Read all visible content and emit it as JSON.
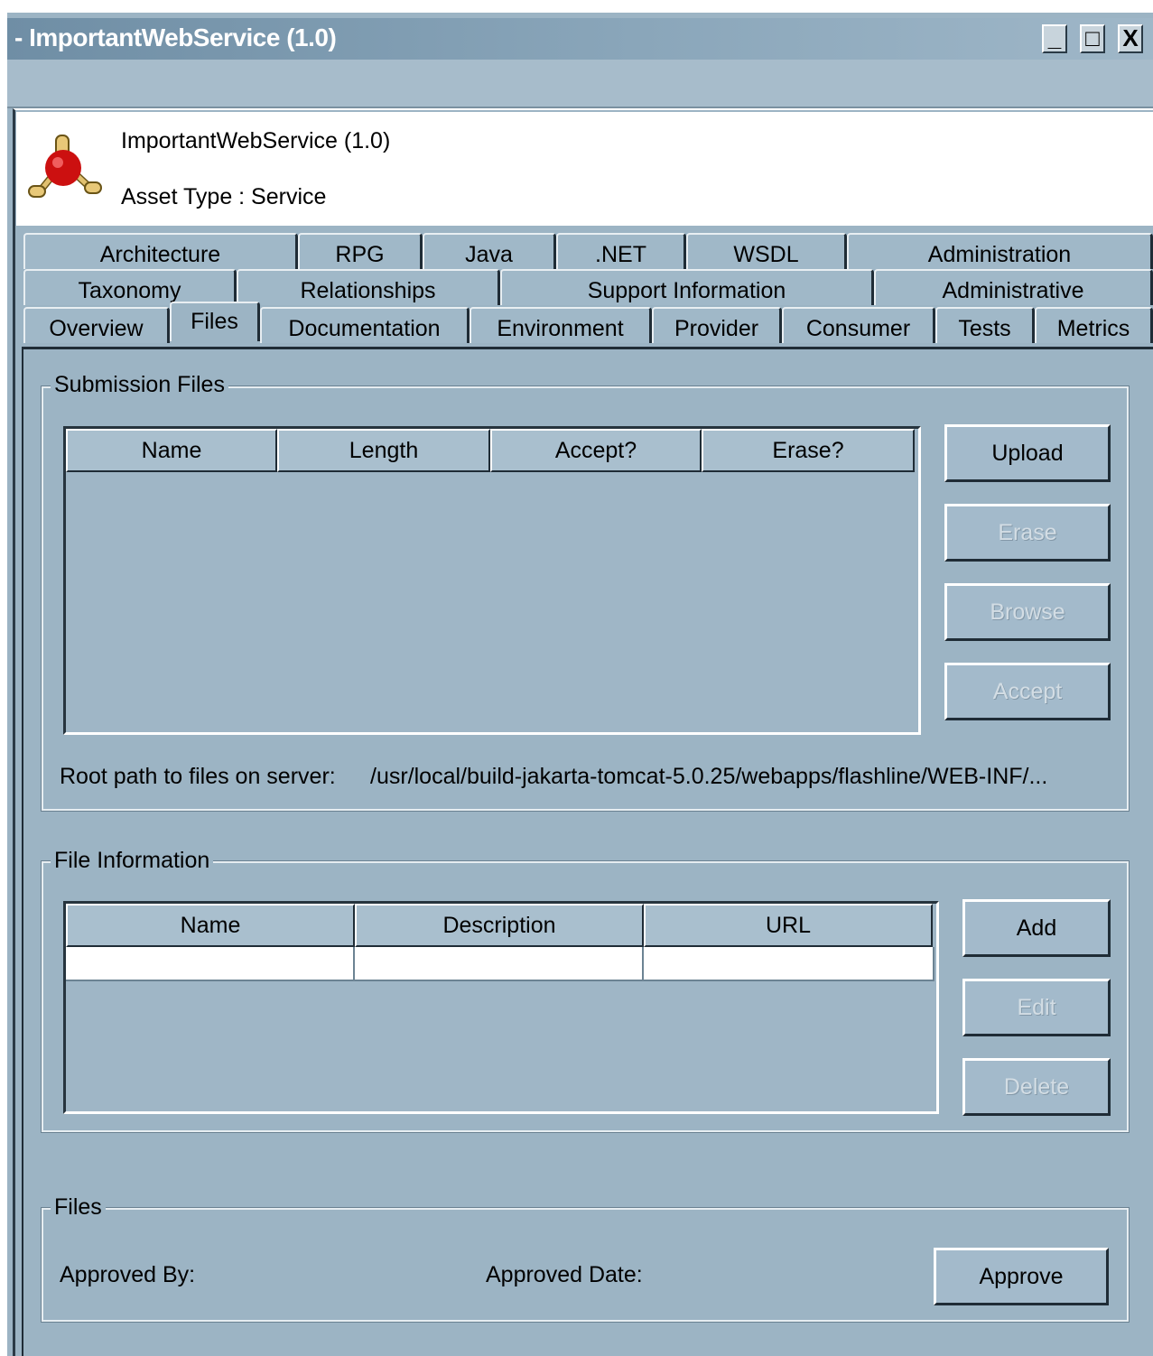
{
  "window": {
    "title": "- ImportantWebService (1.0)",
    "controls": {
      "minimize": "_",
      "maximize": "□",
      "close": "X"
    }
  },
  "header": {
    "asset_name": "ImportantWebService (1.0)",
    "asset_type": "Asset Type : Service",
    "icon": "service-molecule-icon"
  },
  "tabs": {
    "row1": [
      "Architecture",
      "RPG",
      "Java",
      ".NET",
      "WSDL",
      "Administration"
    ],
    "row2": [
      "Taxonomy",
      "Relationships",
      "Support Information",
      "Administrative"
    ],
    "row3": [
      "Overview",
      "Files",
      "Documentation",
      "Environment",
      "Provider",
      "Consumer",
      "Tests",
      "Metrics"
    ],
    "active": "Files"
  },
  "submission_files": {
    "title": "Submission Files",
    "columns": [
      "Name",
      "Length",
      "Accept?",
      "Erase?"
    ],
    "rows": [],
    "buttons": {
      "upload": "Upload",
      "erase": "Erase",
      "browse": "Browse",
      "accept": "Accept"
    },
    "root_path_label": "Root path to files on server:",
    "root_path_value": "/usr/local/build-jakarta-tomcat-5.0.25/webapps/flashline/WEB-INF/..."
  },
  "file_information": {
    "title": "File Information",
    "columns": [
      "Name",
      "Description",
      "URL"
    ],
    "rows": [
      [
        "",
        "",
        ""
      ]
    ],
    "buttons": {
      "add": "Add",
      "edit": "Edit",
      "delete": "Delete"
    }
  },
  "files_approval": {
    "title": "Files",
    "approved_by_label": "Approved By:",
    "approved_date_label": "Approved Date:",
    "approve_button": "Approve"
  },
  "colors": {
    "panel_background": "#9cb4c4",
    "title_bar": "#8aa6ba"
  }
}
